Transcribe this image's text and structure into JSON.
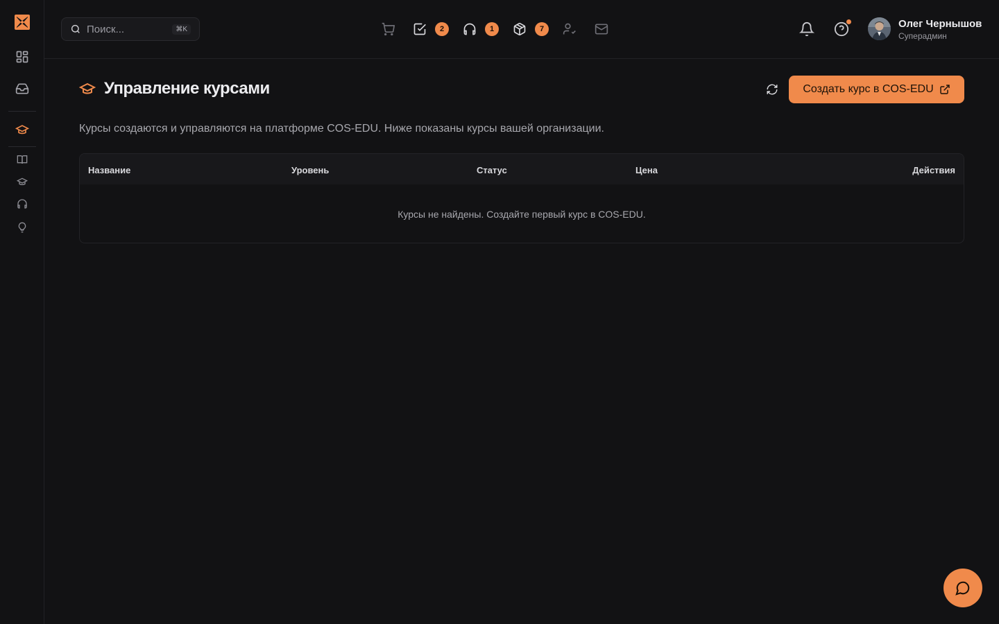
{
  "brand": {
    "accent": "#f08a4b",
    "background": "#121214"
  },
  "search": {
    "placeholder": "Поиск...",
    "shortcut": "⌘K"
  },
  "topbar": {
    "icons": [
      {
        "name": "cart-icon",
        "badge": null
      },
      {
        "name": "tasks-icon",
        "badge": "2"
      },
      {
        "name": "headset-icon",
        "badge": "1"
      },
      {
        "name": "package-icon",
        "badge": "7"
      },
      {
        "name": "user-check-icon",
        "badge": null
      },
      {
        "name": "mail-icon",
        "badge": null
      }
    ],
    "notifications_icon": "bell-icon",
    "help_icon": "help-icon"
  },
  "user": {
    "name": "Олег Чернышов",
    "role": "Суперадмин"
  },
  "sidebar": {
    "items": [
      {
        "name": "dashboard-icon"
      },
      {
        "name": "inbox-icon"
      },
      {
        "name": "graduation-cap-icon",
        "active": true
      },
      {
        "name": "book-icon"
      },
      {
        "name": "graduation-cap-small-icon"
      },
      {
        "name": "headset-small-icon"
      },
      {
        "name": "lightbulb-icon"
      }
    ]
  },
  "page": {
    "title": "Управление курсами",
    "subtitle": "Курсы создаются и управляются на платформе COS-EDU. Ниже показаны курсы вашей организации.",
    "create_button": "Создать курс в COS-EDU"
  },
  "table": {
    "columns": [
      "Название",
      "Уровень",
      "Статус",
      "Цена",
      "Действия"
    ],
    "empty_text": "Курсы не найдены. Создайте первый курс в COS-EDU."
  }
}
